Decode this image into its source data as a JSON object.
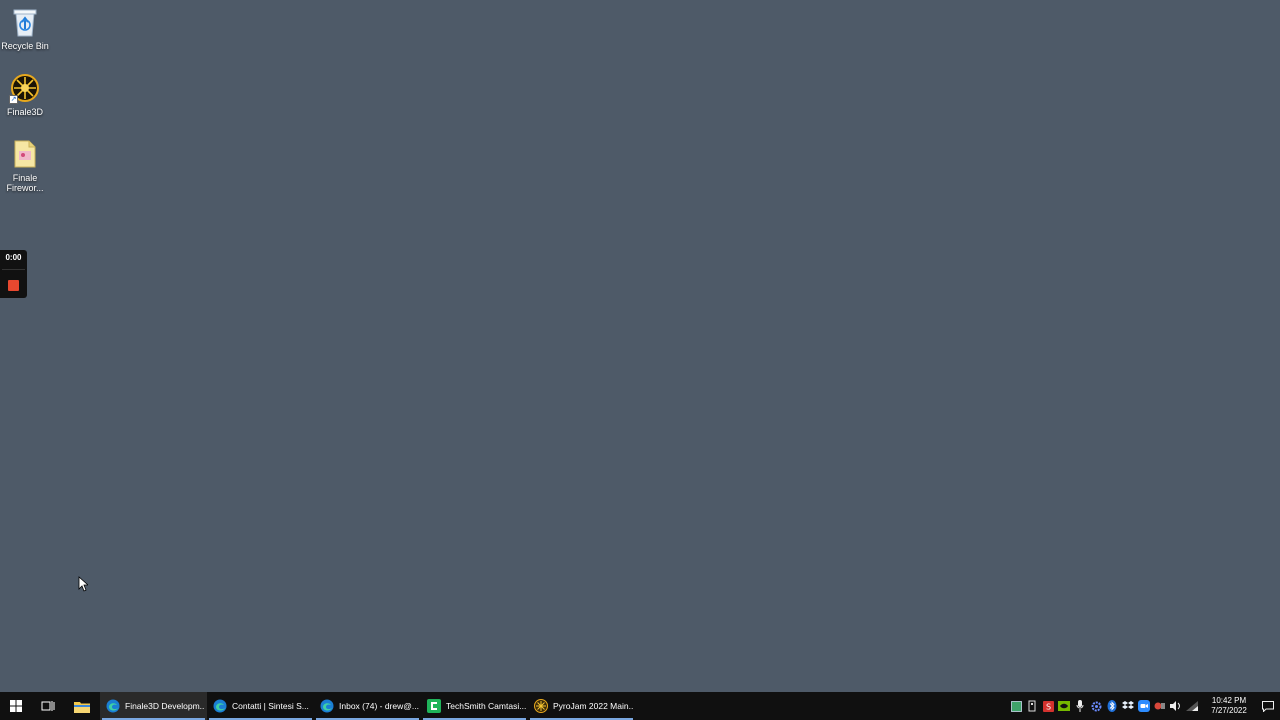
{
  "desktop": {
    "background_color": "#4e5a68",
    "icons": [
      {
        "label": "Recycle Bin",
        "icon": "recycle-bin-icon"
      },
      {
        "label": "Finale3D",
        "icon": "finale3d-icon"
      },
      {
        "label": "Finale Firewor...",
        "icon": "finale-folder-icon"
      }
    ]
  },
  "recorder": {
    "time": "0:00",
    "stop_color": "#e8482f"
  },
  "taskbar": {
    "apps": [
      {
        "label": "Finale3D Developm...",
        "icon": "edge-icon"
      },
      {
        "label": "Contatti | Sintesi S...",
        "icon": "edge-icon"
      },
      {
        "label": "Inbox (74) - drew@...",
        "icon": "edge-icon"
      },
      {
        "label": "TechSmith Camtasi...",
        "icon": "camtasia-icon"
      },
      {
        "label": "PyroJam 2022 Main...",
        "icon": "pyrojam-icon"
      }
    ],
    "clock": {
      "time": "10:42 PM",
      "date": "7/27/2022"
    }
  }
}
